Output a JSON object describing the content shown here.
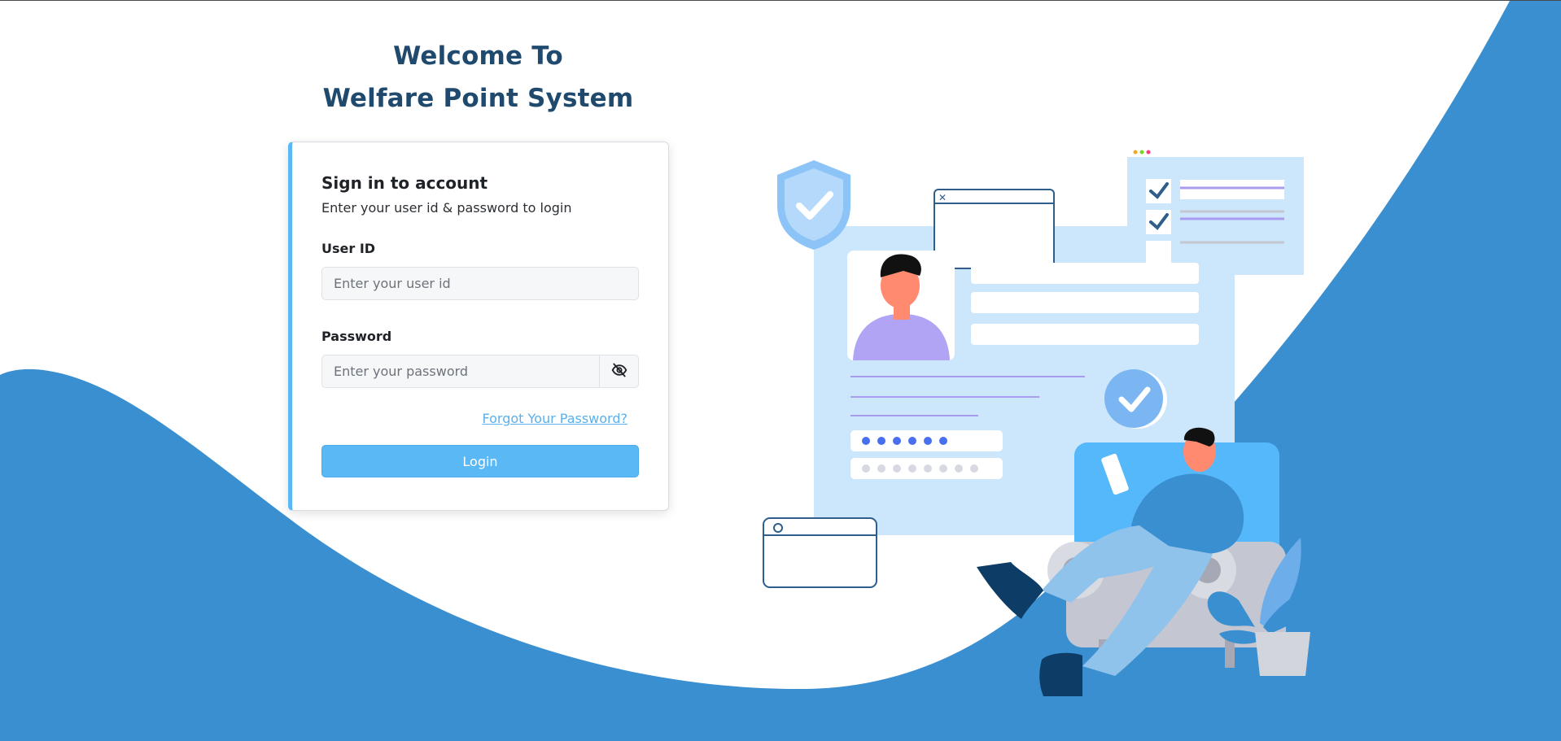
{
  "welcome": {
    "line1": "Welcome To",
    "line2": "Welfare Point System"
  },
  "login": {
    "title": "Sign in to account",
    "subtitle": "Enter your user id & password to login",
    "user_id_label": "User ID",
    "user_id_placeholder": "Enter your user id",
    "user_id_value": "",
    "password_label": "Password",
    "password_placeholder": "Enter your password",
    "password_value": "",
    "forgot_label": "Forgot Your Password?",
    "login_label": "Login"
  },
  "colors": {
    "brand_blue": "#3a8fd0",
    "accent_blue": "#5ab8f5",
    "title_navy": "#1f4a6e",
    "link_blue": "#5ab0ec"
  },
  "icons": {
    "password_toggle": "eye-slash-icon"
  }
}
